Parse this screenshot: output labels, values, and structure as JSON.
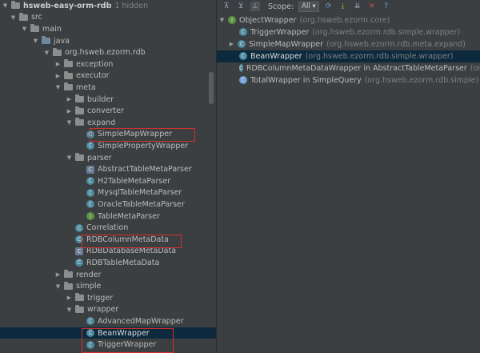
{
  "tree": {
    "project": "hsweb-easy-orm-rdb",
    "hidden": "1 hidden",
    "src": "src",
    "main": "main",
    "java": "java",
    "pkg": "org.hsweb.ezorm.rdb",
    "exception": "exception",
    "executor": "executor",
    "meta": "meta",
    "builder": "builder",
    "converter": "converter",
    "expand": "expand",
    "simple_map_wrapper": "SimpleMapWrapper",
    "simple_property_wrapper": "SimplePropertyWrapper",
    "parser": "parser",
    "abstract_table_meta_parser": "AbstractTableMetaParser",
    "h2_table_meta_parser": "H2TableMetaParser",
    "mysql_table_meta_parser": "MysqlTableMetaParser",
    "oracle_table_meta_parser": "OracleTableMetaParser",
    "table_meta_parser": "TableMetaParser",
    "correlation": "Correlation",
    "rdb_column_meta_data": "RDBColumnMetaData",
    "rdb_database_meta_data": "RDBDatabaseMetaData",
    "rdb_table_meta_data": "RDBTableMetaData",
    "render": "render",
    "simple": "simple",
    "trigger": "trigger",
    "wrapper": "wrapper",
    "advanced_map_wrapper": "AdvancedMapWrapper",
    "bean_wrapper": "BeanWrapper",
    "trigger_wrapper": "TriggerWrapper"
  },
  "hierarchy": {
    "scope_label": "Scope:",
    "scope_value": "All",
    "items": [
      {
        "name": "ObjectWrapper",
        "pkg": "(org.hsweb.ezorm.core)"
      },
      {
        "name": "TriggerWrapper",
        "pkg": "(org.hsweb.ezorm.rdb.simple.wrapper)"
      },
      {
        "name": "SimpleMapWrapper",
        "pkg": "(org.hsweb.ezorm.rdb.meta.expand)"
      },
      {
        "name": "BeanWrapper",
        "pkg": "(org.hsweb.ezorm.rdb.simple.wrapper)"
      },
      {
        "name": "RDBColumnMetaDataWrapper in AbstractTableMetaParser",
        "pkg": "(org.hsw"
      },
      {
        "name": "TotalWrapper in SimpleQuery",
        "pkg": "(org.hsweb.ezorm.rdb.simple)"
      }
    ]
  },
  "colors": {
    "background": "#3c3f41",
    "selection": "#0d293e",
    "highlight_box": "#d32f2f"
  }
}
